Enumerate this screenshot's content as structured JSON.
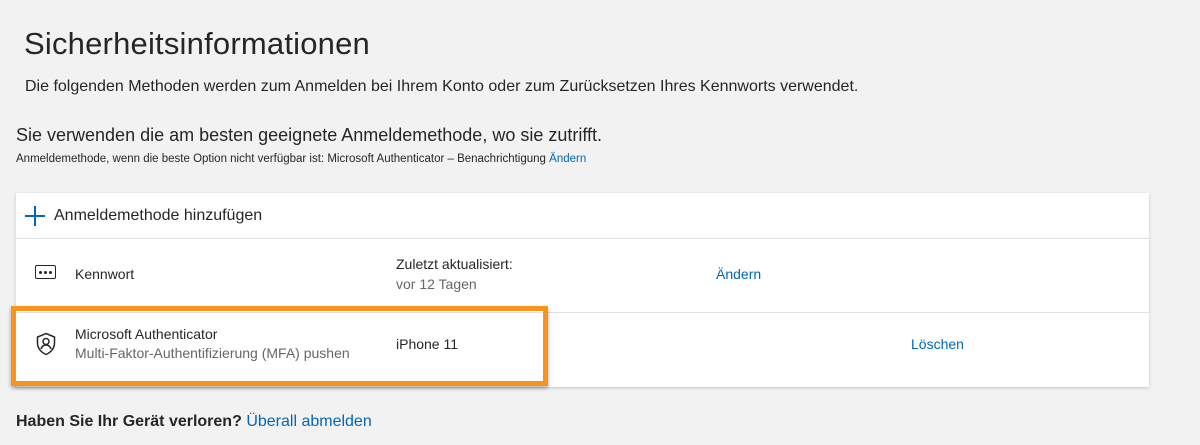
{
  "header": {
    "title": "Sicherheitsinformationen",
    "description": "Die folgenden Methoden werden zum Anmelden bei Ihrem Konto oder zum Zurücksetzen Ihres Kennworts verwendet."
  },
  "default_method": {
    "heading": "Sie verwenden die am besten geeignete Anmeldemethode, wo sie zutrifft.",
    "fallback_text": "Anmeldemethode, wenn die beste Option nicht verfügbar ist: Microsoft Authenticator – Benachrichtigung",
    "change_link": "Ändern"
  },
  "methods": {
    "add_label": "Anmeldemethode hinzufügen",
    "items": [
      {
        "icon": "password-dots-icon",
        "name": "Kennwort",
        "detail_label": "Zuletzt aktualisiert:",
        "detail_value": "vor 12 Tagen",
        "action": "Ändern"
      },
      {
        "icon": "authenticator-icon",
        "name": "Microsoft Authenticator",
        "subtitle": "Multi-Faktor-Authentifizierung (MFA) pushen",
        "detail_value": "iPhone 11",
        "action": "Löschen"
      }
    ]
  },
  "lost_device": {
    "question": "Haben Sie Ihr Gerät verloren?",
    "link": "Überall abmelden"
  },
  "colors": {
    "link": "#0067b8",
    "highlight": "#f7941d",
    "background": "#f2f2f2"
  }
}
